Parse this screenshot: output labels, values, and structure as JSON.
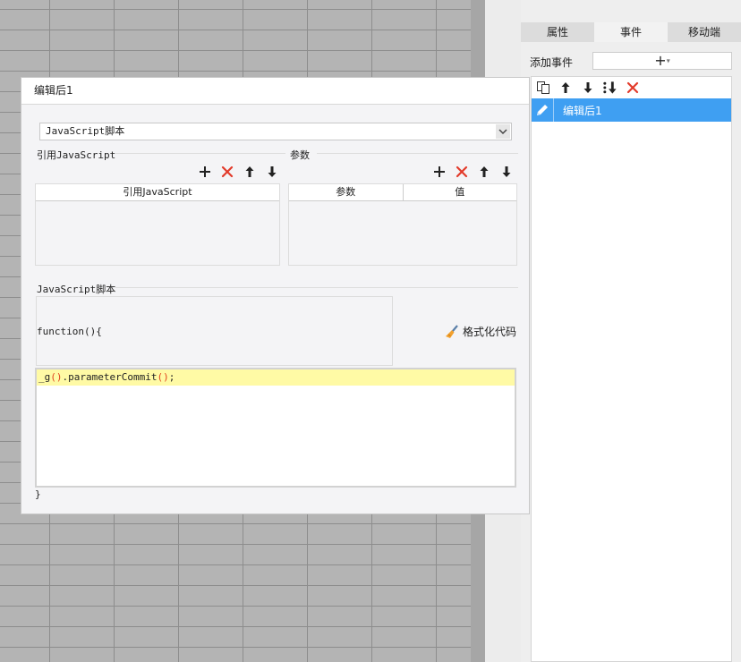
{
  "right_panel": {
    "tabs": [
      "属性",
      "事件",
      "移动端"
    ],
    "active_tab": "事件",
    "add_event_label": "添加事件",
    "add_event_symbol": "+",
    "events": [
      {
        "label": "编辑后1",
        "selected": true
      }
    ]
  },
  "dialog": {
    "title": "编辑后1",
    "script_type": "JavaScript脚本",
    "ref_section_label": "引用JavaScript",
    "ref_table_header": "引用JavaScript",
    "param_section_label": "参数",
    "param_headers": [
      "参数",
      "值"
    ],
    "script_section_label": "JavaScript脚本",
    "function_header": "function(){",
    "format_button_label": "格式化代码",
    "code_line": {
      "ident": "_g",
      "p1": "()",
      "mid": ".parameterCommit",
      "p2": "()",
      "end": ";"
    },
    "closing_brace": "}"
  },
  "colors": {
    "selection_blue": "#3f9ff2",
    "delete_red": "#e23a2a",
    "code_highlight": "#fffaa5"
  }
}
